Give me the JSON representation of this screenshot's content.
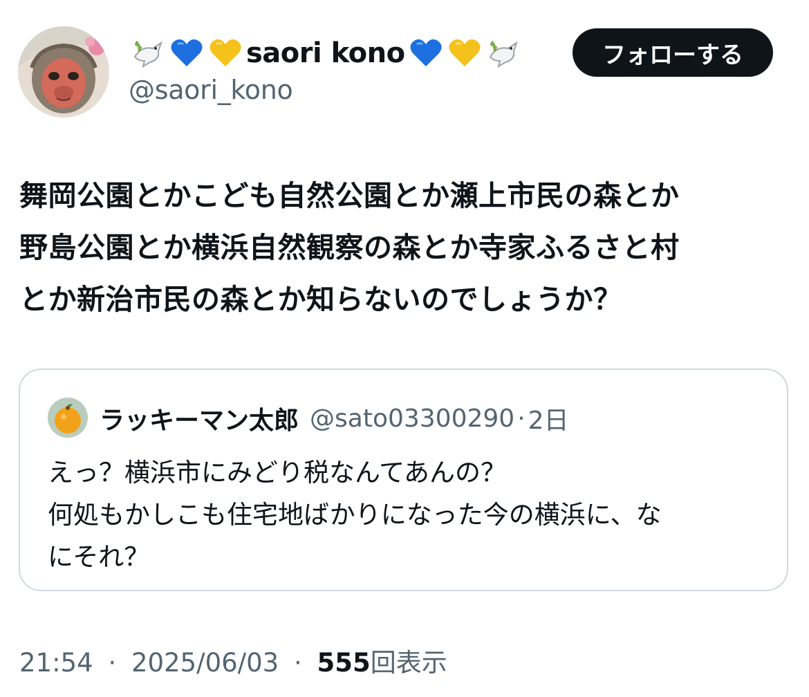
{
  "author": {
    "display_name": "saori kono",
    "handle": "@saori_kono",
    "avatar_icon": "monkey-painting-avatar",
    "name_emojis_before": [
      "dove-icon",
      "blue-heart-icon",
      "yellow-heart-icon"
    ],
    "name_emojis_after": [
      "blue-heart-icon",
      "yellow-heart-icon",
      "dove-icon"
    ]
  },
  "follow_button": {
    "label": "フォローする"
  },
  "tweet": {
    "lines": [
      "舞岡公園とかこども自然公園とか瀬上市民の森とか",
      "野島公園とか横浜自然観察の森とか寺家ふるさと村",
      "とか新治市民の森とか知らないのでしょうか？"
    ]
  },
  "quoted_tweet": {
    "display_name": "ラッキーマン太郎",
    "handle": "@sato03300290",
    "separator": "·",
    "time": "2日",
    "avatar_icon": "orange-fruit-avatar",
    "lines": [
      "えっ？横浜市にみどり税なんてあんの？",
      "何処もかしこも住宅地ばかりになった今の横浜に、な",
      "にそれ？"
    ]
  },
  "meta": {
    "time": "21:54",
    "separator": "·",
    "date": "2025/06/03",
    "views_count": "555",
    "views_label": "回表示"
  },
  "colors": {
    "text_primary": "#0f1419",
    "text_secondary": "#536471",
    "border": "#cfd9de",
    "button_bg": "#0f1419",
    "heart_blue": "#1d6fe0",
    "heart_yellow": "#f5c21b"
  }
}
